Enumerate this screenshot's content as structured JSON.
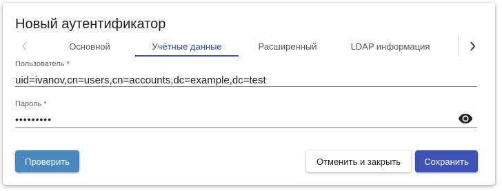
{
  "dialog": {
    "title": "Новый аутентификатор"
  },
  "tabs": {
    "items": [
      {
        "label": "Основной",
        "active": false
      },
      {
        "label": "Учётные данные",
        "active": true
      },
      {
        "label": "Расширенный",
        "active": false
      },
      {
        "label": "LDAP информация",
        "active": false
      }
    ],
    "left_arrow_icon": "chevron-left-icon",
    "right_arrow_icon": "chevron-right-icon"
  },
  "form": {
    "user": {
      "label": "Пользователь *",
      "value": "uid=ivanov,cn=users,cn=accounts,dc=example,dc=test"
    },
    "password": {
      "label": "Пароль *",
      "value": "•••••••••",
      "toggle_icon": "eye-icon"
    }
  },
  "actions": {
    "check_label": "Проверить",
    "cancel_label": "Отменить и закрыть",
    "save_label": "Сохранить"
  },
  "colors": {
    "accent": "#3f51b5",
    "active_tab_text": "#2e41a6",
    "check_button": "#4a87bf",
    "save_button": "#3f51b5"
  }
}
